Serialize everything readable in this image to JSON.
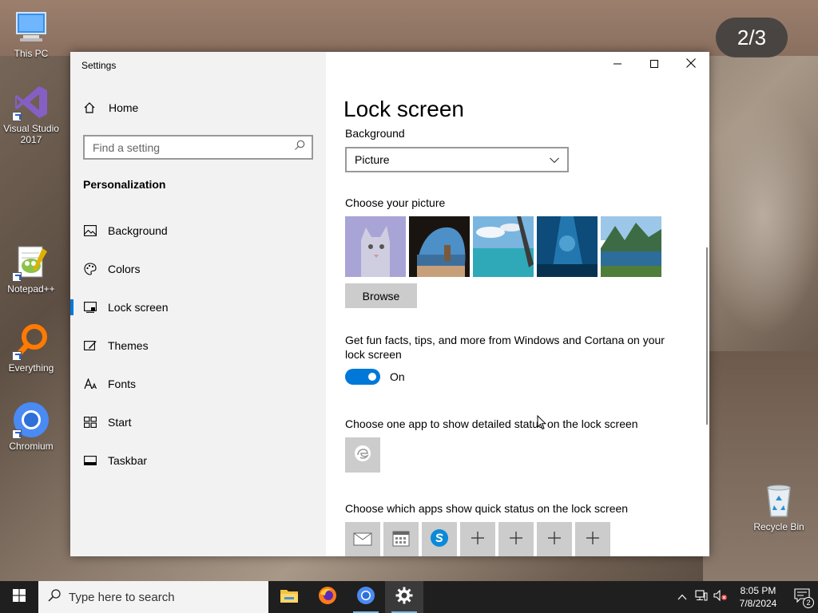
{
  "desktop": {
    "icons": [
      {
        "label": "This PC"
      },
      {
        "label": "Visual Studio 2017"
      },
      {
        "label": "Notepad++"
      },
      {
        "label": "Everything"
      },
      {
        "label": "Chromium"
      },
      {
        "label": "Recycle Bin"
      }
    ],
    "page_counter": "2/3"
  },
  "window": {
    "title": "Settings",
    "buttons": {
      "minimize": "minimize-icon",
      "maximize": "maximize-icon",
      "close": "close-icon"
    }
  },
  "sidebar": {
    "home_label": "Home",
    "search_placeholder": "Find a setting",
    "section_title": "Personalization",
    "items": [
      {
        "label": "Background",
        "icon": "image-icon"
      },
      {
        "label": "Colors",
        "icon": "palette-icon"
      },
      {
        "label": "Lock screen",
        "icon": "lock-screen-icon",
        "active": true
      },
      {
        "label": "Themes",
        "icon": "themes-icon"
      },
      {
        "label": "Fonts",
        "icon": "fonts-icon"
      },
      {
        "label": "Start",
        "icon": "start-icon"
      },
      {
        "label": "Taskbar",
        "icon": "taskbar-icon"
      }
    ]
  },
  "main": {
    "page_title": "Lock screen",
    "background_label": "Background",
    "background_value": "Picture",
    "choose_picture_label": "Choose your picture",
    "browse_label": "Browse",
    "fun_facts_label": "Get fun facts, tips, and more from Windows and Cortana on your lock screen",
    "toggle_state": "On",
    "detailed_status_label": "Choose one app to show detailed status on the lock screen",
    "quick_status_label": "Choose which apps show quick status on the lock screen"
  },
  "taskbar": {
    "search_placeholder": "Type here to search",
    "time": "8:05 PM",
    "date": "7/8/2024",
    "notification_count": "2"
  },
  "colors": {
    "accent": "#0078d7",
    "sidebar_bg": "#f2f2f2",
    "taskbar_bg": "#1f1f1f"
  }
}
